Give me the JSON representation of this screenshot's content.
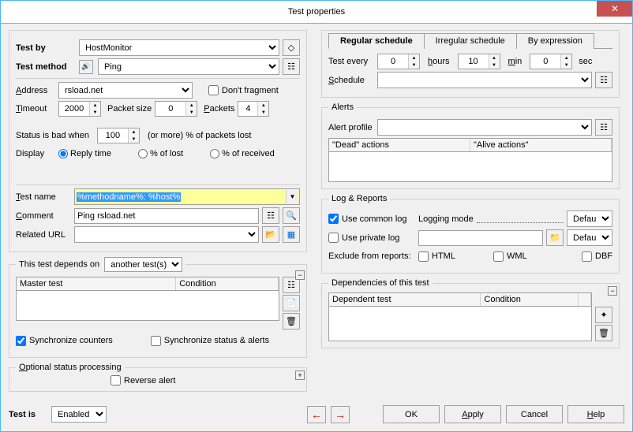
{
  "window": {
    "title": "Test properties"
  },
  "left": {
    "test_by_lbl": "Test by",
    "test_by_val": "HostMonitor",
    "test_method_lbl": "Test method",
    "test_method_val": "Ping",
    "address_lbl": "Address",
    "address_val": "rsload.net",
    "dont_fragment_lbl": "Don't fragment",
    "timeout_lbl": "Timeout",
    "timeout_val": "2000",
    "packet_size_lbl": "Packet size",
    "packet_size_val": "0",
    "packets_lbl": "Packets",
    "packets_val": "4",
    "status_bad_lbl": "Status is bad when",
    "status_bad_val": "100",
    "status_bad_suffix": "(or more) % of packets lost",
    "display_lbl": "Display",
    "display_reply": "Reply time",
    "display_lost": "% of lost",
    "display_received": "% of received",
    "test_name_lbl": "Test name",
    "test_name_val": "%methodname%: %host%",
    "comment_lbl": "Comment",
    "comment_val": "Ping rsload.net",
    "related_url_lbl": "Related URL",
    "related_url_val": "",
    "depends_lbl": "This test depends on",
    "depends_val": "another test(s)",
    "master_hdr": "Master test",
    "condition_hdr": "Condition",
    "sync_counters": "Synchronize counters",
    "sync_status": "Synchronize status & alerts",
    "opt_status": "Optional status processing",
    "reverse_alert": "Reverse alert",
    "test_is_lbl": "Test is",
    "test_is_val": "Enabled"
  },
  "right": {
    "tab_regular": "Regular schedule",
    "tab_irregular": "Irregular schedule",
    "tab_expr": "By expression",
    "test_every_lbl": "Test every",
    "hours_val": "0",
    "hours_lbl": "hours",
    "mins_val": "10",
    "mins_lbl": "min",
    "secs_val": "0",
    "secs_lbl": "sec",
    "schedule_lbl": "Schedule",
    "schedule_val": "",
    "alerts_legend": "Alerts",
    "alert_profile_lbl": "Alert profile",
    "alert_profile_val": "",
    "dead_hdr": "\"Dead\" actions",
    "alive_hdr": "\"Alive actions\"",
    "log_legend": "Log & Reports",
    "use_common": "Use common log",
    "use_private": "Use private log",
    "logging_mode": "Logging mode",
    "default1": "Default",
    "default2": "Default",
    "exclude_lbl": "Exclude from reports:",
    "html": "HTML",
    "wml": "WML",
    "dbf": "DBF",
    "deps_legend": "Dependencies of this test",
    "dependent_hdr": "Dependent test",
    "condition_hdr2": "Condition"
  },
  "buttons": {
    "ok": "OK",
    "apply": "Apply",
    "cancel": "Cancel",
    "help": "Help"
  }
}
